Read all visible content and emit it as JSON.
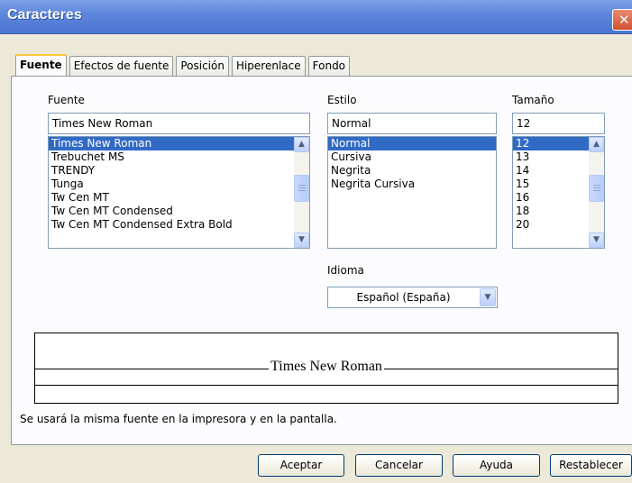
{
  "window": {
    "title": "Caracteres",
    "close_glyph": "✕"
  },
  "tabs": [
    {
      "label": "Fuente",
      "active": true
    },
    {
      "label": "Efectos de fuente",
      "active": false
    },
    {
      "label": "Posición",
      "active": false
    },
    {
      "label": "Hiperenlace",
      "active": false
    },
    {
      "label": "Fondo",
      "active": false
    }
  ],
  "font": {
    "label": "Fuente",
    "value": "Times New Roman",
    "items": [
      "Times New Roman",
      "Trebuchet MS",
      "TRENDY",
      "Tunga",
      "Tw Cen MT",
      "Tw Cen MT Condensed",
      "Tw Cen MT Condensed Extra Bold"
    ],
    "selected_index": 0
  },
  "style": {
    "label": "Estilo",
    "value": "Normal",
    "items": [
      "Normal",
      "Cursiva",
      "Negrita",
      "Negrita Cursiva"
    ],
    "selected_index": 0
  },
  "size": {
    "label": "Tamaño",
    "value": "12",
    "items": [
      "12",
      "13",
      "14",
      "15",
      "16",
      "18",
      "20"
    ],
    "selected_index": 0
  },
  "language": {
    "label": "Idioma",
    "value": "Español (España)"
  },
  "preview": {
    "sample_text": "Times New Roman"
  },
  "info_text": "Se usará la misma fuente en la impresora y en la pantalla.",
  "buttons": {
    "ok": "Aceptar",
    "cancel": "Cancelar",
    "help": "Ayuda",
    "reset": "Restablecer"
  },
  "colors": {
    "selection": "#316ac5",
    "title_bar": "#5e87dc",
    "dialog_bg": "#ece9d8"
  },
  "icons": {
    "scroll_up": "▲",
    "scroll_down": "▼",
    "dropdown": "▼"
  }
}
